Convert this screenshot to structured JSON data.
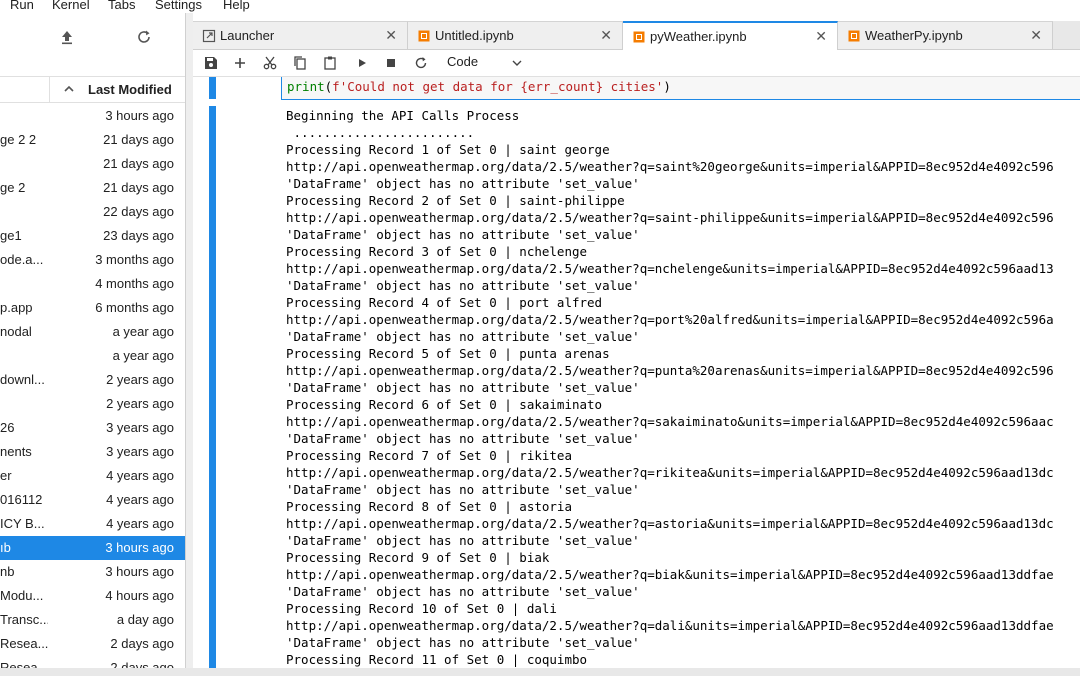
{
  "menubar": {
    "items": [
      "Run",
      "Kernel",
      "Tabs",
      "Settings",
      "Help"
    ]
  },
  "sidebar": {
    "toolbar_icons": [
      "upload-icon",
      "refresh-icon"
    ],
    "header": {
      "sort_icon": "chevron-up-icon",
      "column_label": "Last Modified"
    },
    "files": [
      {
        "name": "",
        "modified": "3 hours ago"
      },
      {
        "name": "ge 2 2",
        "modified": "21 days ago"
      },
      {
        "name": "",
        "modified": "21 days ago"
      },
      {
        "name": "ge 2",
        "modified": "21 days ago"
      },
      {
        "name": "",
        "modified": "22 days ago"
      },
      {
        "name": "ge1",
        "modified": "23 days ago"
      },
      {
        "name": "ode.a...",
        "modified": "3 months ago"
      },
      {
        "name": "",
        "modified": "4 months ago"
      },
      {
        "name": "p.app",
        "modified": "6 months ago"
      },
      {
        "name": "nodal",
        "modified": "a year ago"
      },
      {
        "name": "",
        "modified": "a year ago"
      },
      {
        "name": "downl...",
        "modified": "2 years ago"
      },
      {
        "name": "",
        "modified": "2 years ago"
      },
      {
        "name": "26",
        "modified": "3 years ago"
      },
      {
        "name": "nents",
        "modified": "3 years ago"
      },
      {
        "name": "er",
        "modified": "4 years ago"
      },
      {
        "name": "016112",
        "modified": "4 years ago"
      },
      {
        "name": "ICY B...",
        "modified": "4 years ago"
      },
      {
        "name": "ıb",
        "modified": "3 hours ago",
        "selected": true
      },
      {
        "name": "nb",
        "modified": "3 hours ago"
      },
      {
        "name": " Modu...",
        "modified": "4 hours ago"
      },
      {
        "name": "Transc...",
        "modified": "a day ago"
      },
      {
        "name": "Resea...",
        "modified": "2 days ago"
      },
      {
        "name": "Resea...",
        "modified": "2 days ago"
      }
    ]
  },
  "tabs": [
    {
      "label": "Launcher",
      "icon": "launcher-icon",
      "active": false
    },
    {
      "label": "Untitled.ipynb",
      "icon": "notebook-icon",
      "active": false
    },
    {
      "label": "pyWeather.ipynb",
      "icon": "notebook-icon",
      "active": true
    },
    {
      "label": "WeatherPy.ipynb",
      "icon": "notebook-icon",
      "active": false
    }
  ],
  "toolbar": {
    "buttons": [
      "save-icon",
      "add-icon",
      "cut-icon",
      "copy-icon",
      "paste-icon",
      "run-icon",
      "stop-icon",
      "restart-icon"
    ],
    "cell_type": "Code"
  },
  "code_cell": {
    "fn": "print",
    "open": "(",
    "string": "f'Could not get data for {err_count} cities'",
    "close": ")"
  },
  "output_lines": [
    "Beginning the API Calls Process",
    " ........................",
    "Processing Record 1 of Set 0 | saint george",
    "http://api.openweathermap.org/data/2.5/weather?q=saint%20george&units=imperial&APPID=8ec952d4e4092c596",
    "'DataFrame' object has no attribute 'set_value'",
    "Processing Record 2 of Set 0 | saint-philippe",
    "http://api.openweathermap.org/data/2.5/weather?q=saint-philippe&units=imperial&APPID=8ec952d4e4092c596",
    "'DataFrame' object has no attribute 'set_value'",
    "Processing Record 3 of Set 0 | nchelenge",
    "http://api.openweathermap.org/data/2.5/weather?q=nchelenge&units=imperial&APPID=8ec952d4e4092c596aad13",
    "'DataFrame' object has no attribute 'set_value'",
    "Processing Record 4 of Set 0 | port alfred",
    "http://api.openweathermap.org/data/2.5/weather?q=port%20alfred&units=imperial&APPID=8ec952d4e4092c596a",
    "'DataFrame' object has no attribute 'set_value'",
    "Processing Record 5 of Set 0 | punta arenas",
    "http://api.openweathermap.org/data/2.5/weather?q=punta%20arenas&units=imperial&APPID=8ec952d4e4092c596",
    "'DataFrame' object has no attribute 'set_value'",
    "Processing Record 6 of Set 0 | sakaiminato",
    "http://api.openweathermap.org/data/2.5/weather?q=sakaiminato&units=imperial&APPID=8ec952d4e4092c596aac",
    "'DataFrame' object has no attribute 'set_value'",
    "Processing Record 7 of Set 0 | rikitea",
    "http://api.openweathermap.org/data/2.5/weather?q=rikitea&units=imperial&APPID=8ec952d4e4092c596aad13dc",
    "'DataFrame' object has no attribute 'set_value'",
    "Processing Record 8 of Set 0 | astoria",
    "http://api.openweathermap.org/data/2.5/weather?q=astoria&units=imperial&APPID=8ec952d4e4092c596aad13dc",
    "'DataFrame' object has no attribute 'set_value'",
    "Processing Record 9 of Set 0 | biak",
    "http://api.openweathermap.org/data/2.5/weather?q=biak&units=imperial&APPID=8ec952d4e4092c596aad13ddfae",
    "'DataFrame' object has no attribute 'set_value'",
    "Processing Record 10 of Set 0 | dali",
    "http://api.openweathermap.org/data/2.5/weather?q=dali&units=imperial&APPID=8ec952d4e4092c596aad13ddfae",
    "'DataFrame' object has no attribute 'set_value'",
    "Processing Record 11 of Set 0 | coquimbo"
  ],
  "colors": {
    "accent": "#1e88e5",
    "notebook_icon": "#f57c00",
    "string_token": "#ba2121",
    "builtin_token": "#008000"
  }
}
